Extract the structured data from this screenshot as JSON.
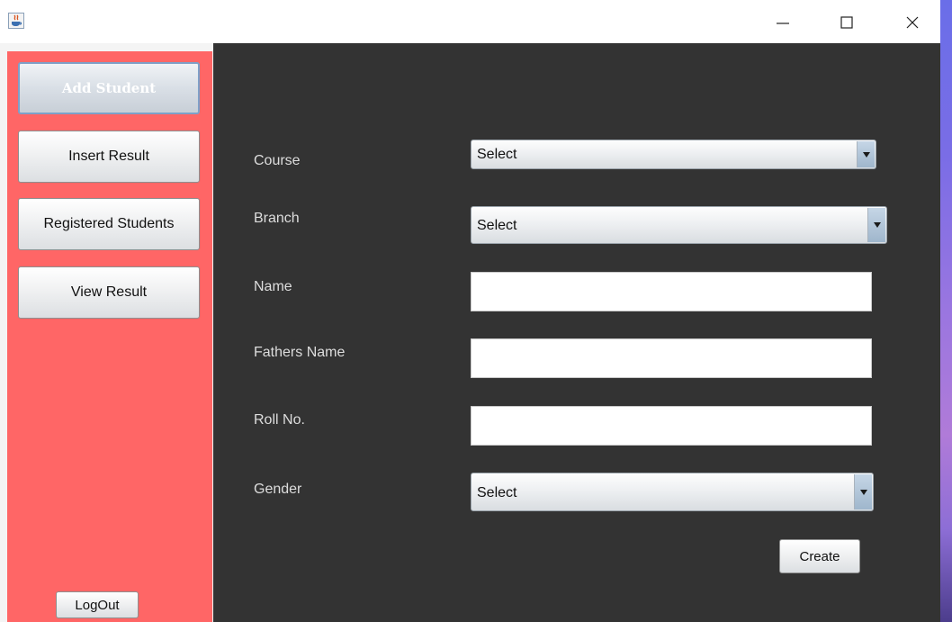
{
  "window": {
    "icon": "java-cup-icon",
    "controls": [
      "minimize-icon",
      "maximize-icon",
      "close-icon"
    ]
  },
  "sidebar": {
    "items": [
      {
        "label": "Add Student",
        "active": true
      },
      {
        "label": "Insert Result",
        "active": false
      },
      {
        "label": "Registered Students",
        "active": false
      },
      {
        "label": "View Result",
        "active": false
      }
    ],
    "logout_label": "LogOut",
    "background": "#ff6666"
  },
  "form": {
    "course": {
      "label": "Course",
      "value": "Select"
    },
    "branch": {
      "label": "Branch",
      "value": "Select"
    },
    "name": {
      "label": "Name",
      "value": ""
    },
    "fathers_name": {
      "label": "Fathers Name",
      "value": ""
    },
    "roll_no": {
      "label": "Roll No.",
      "value": ""
    },
    "gender": {
      "label": "Gender",
      "value": "Select"
    },
    "create_label": "Create",
    "background": "#333333"
  }
}
